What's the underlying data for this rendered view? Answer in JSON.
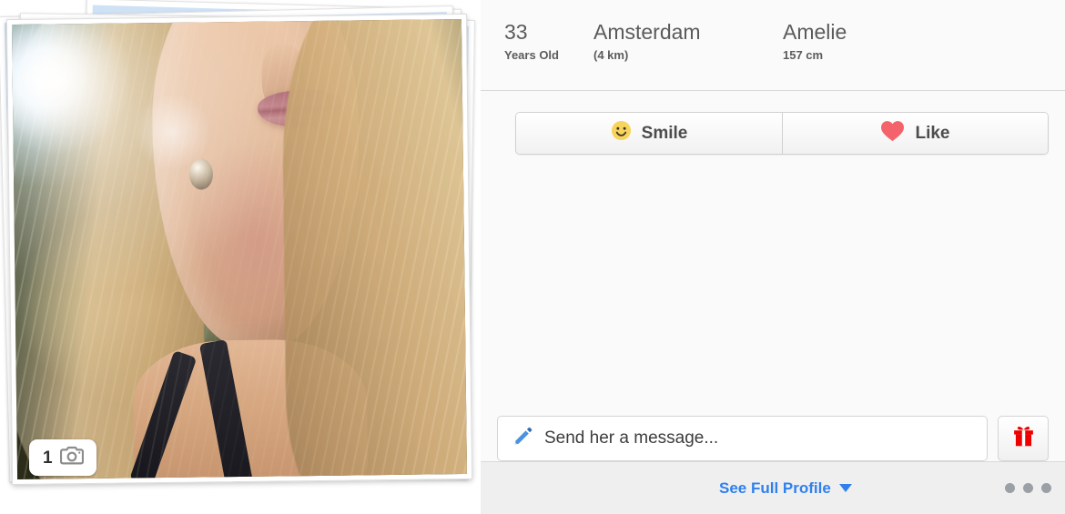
{
  "profile": {
    "age_value": "33",
    "age_label": "Years Old",
    "location_value": "Amsterdam",
    "location_distance": "(4 km)",
    "name_value": "Amelie",
    "height_value": "157 cm"
  },
  "photo": {
    "count": "1",
    "camera_icon": "camera-icon"
  },
  "actions": {
    "smile_label": "Smile",
    "smile_icon": "smiley-face-icon",
    "like_label": "Like",
    "like_icon": "heart-icon"
  },
  "message": {
    "placeholder": "Send her a message...",
    "pencil_icon": "pencil-icon",
    "gift_icon": "gift-icon"
  },
  "footer": {
    "see_profile_label": "See Full Profile",
    "caret_icon": "chevron-down-icon",
    "dots_icon": "more-options-dots-icon"
  },
  "colors": {
    "accent_blue": "#2f80ed",
    "heart_red": "#f4636b",
    "gift_red": "#ee0000",
    "smile_yellow": "#f7d563",
    "panel_bg": "#fafafa",
    "footer_bg": "#efefef",
    "text_gray": "#5b5b5b"
  }
}
